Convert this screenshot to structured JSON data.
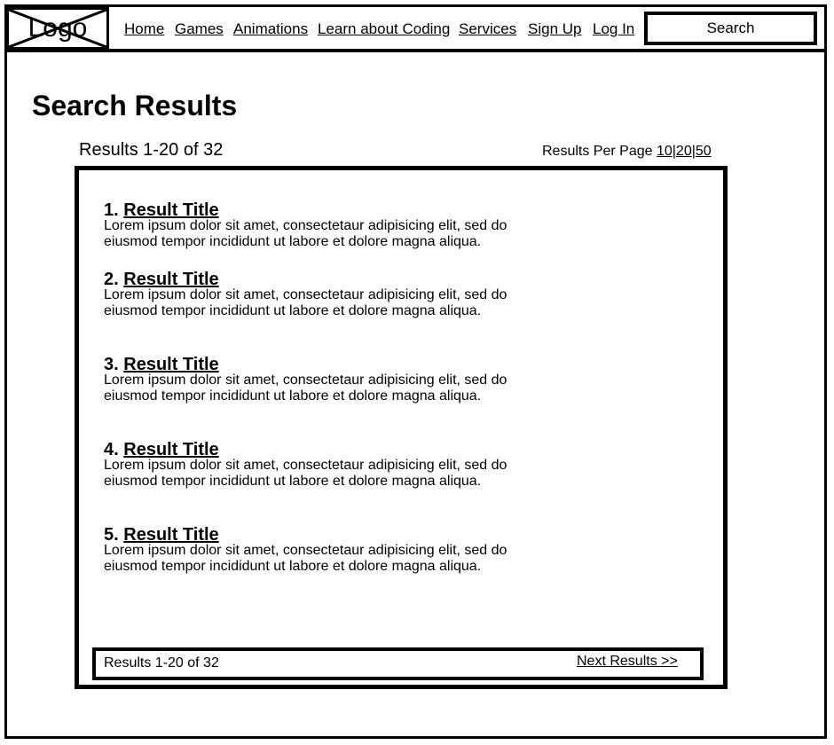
{
  "header": {
    "logo_text": "Logo",
    "nav": {
      "home": "Home",
      "games": "Games",
      "animations": "Animations",
      "learn": "Learn about Coding",
      "services": "Services",
      "signup": "Sign Up",
      "login": "Log In"
    },
    "search_label": "Search"
  },
  "main": {
    "title": "Search Results",
    "results_count": "Results 1-20 of 32",
    "per_page": {
      "label": "Results Per Page",
      "opt_10": "10",
      "opt_20": "20",
      "opt_50": "50",
      "separator": "|"
    },
    "results": [
      {
        "number": "1.",
        "title": "Result Title",
        "desc": "Lorem ipsum dolor sit amet, consectetaur adipisicing elit, sed do eiusmod tempor incididunt ut labore et dolore magna aliqua."
      },
      {
        "number": "2.",
        "title": "Result Title",
        "desc": "Lorem ipsum dolor sit amet, consectetaur adipisicing elit, sed do eiusmod tempor incididunt ut labore et dolore magna aliqua."
      },
      {
        "number": "3.",
        "title": "Result Title",
        "desc": "Lorem ipsum dolor sit amet, consectetaur adipisicing elit, sed do eiusmod tempor incididunt ut labore et dolore magna aliqua."
      },
      {
        "number": "4.",
        "title": "Result Title",
        "desc": "Lorem ipsum dolor sit amet, consectetaur adipisicing elit, sed do eiusmod tempor incididunt ut labore et dolore magna aliqua."
      },
      {
        "number": "5.",
        "title": "Result Title",
        "desc": "Lorem ipsum dolor sit amet, consectetaur adipisicing elit, sed do eiusmod tempor incididunt ut labore et dolore magna aliqua."
      }
    ],
    "footer": {
      "count": "Results 1-20 of 32",
      "next": "Next Results >>"
    }
  }
}
